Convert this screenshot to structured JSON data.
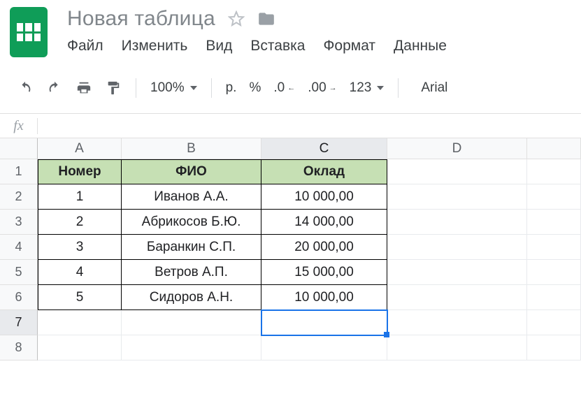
{
  "doc_title": "Новая таблица",
  "menu": {
    "file": "Файл",
    "edit": "Изменить",
    "view": "Вид",
    "insert": "Вставка",
    "format": "Формат",
    "data": "Данные"
  },
  "toolbar": {
    "zoom": "100%",
    "currency": "р.",
    "percent": "%",
    "dec_less": ".0",
    "dec_more": ".00",
    "num_fmt": "123",
    "font": "Arial"
  },
  "fx_label": "fx",
  "fx_value": "",
  "columns": [
    "A",
    "B",
    "C",
    "D",
    ""
  ],
  "row_nums": [
    "1",
    "2",
    "3",
    "4",
    "5",
    "6",
    "7",
    "8"
  ],
  "table": {
    "headers": {
      "num": "Номер",
      "name": "ФИО",
      "salary": "Оклад"
    },
    "rows": [
      {
        "num": "1",
        "name": "Иванов А.А.",
        "salary": "10 000,00"
      },
      {
        "num": "2",
        "name": "Абрикосов Б.Ю.",
        "salary": "14 000,00"
      },
      {
        "num": "3",
        "name": "Баранкин С.П.",
        "salary": "20 000,00"
      },
      {
        "num": "4",
        "name": "Ветров А.П.",
        "salary": "15 000,00"
      },
      {
        "num": "5",
        "name": "Сидоров А.Н.",
        "salary": "10 000,00"
      }
    ]
  },
  "selection": {
    "col": "C",
    "row": 7
  }
}
